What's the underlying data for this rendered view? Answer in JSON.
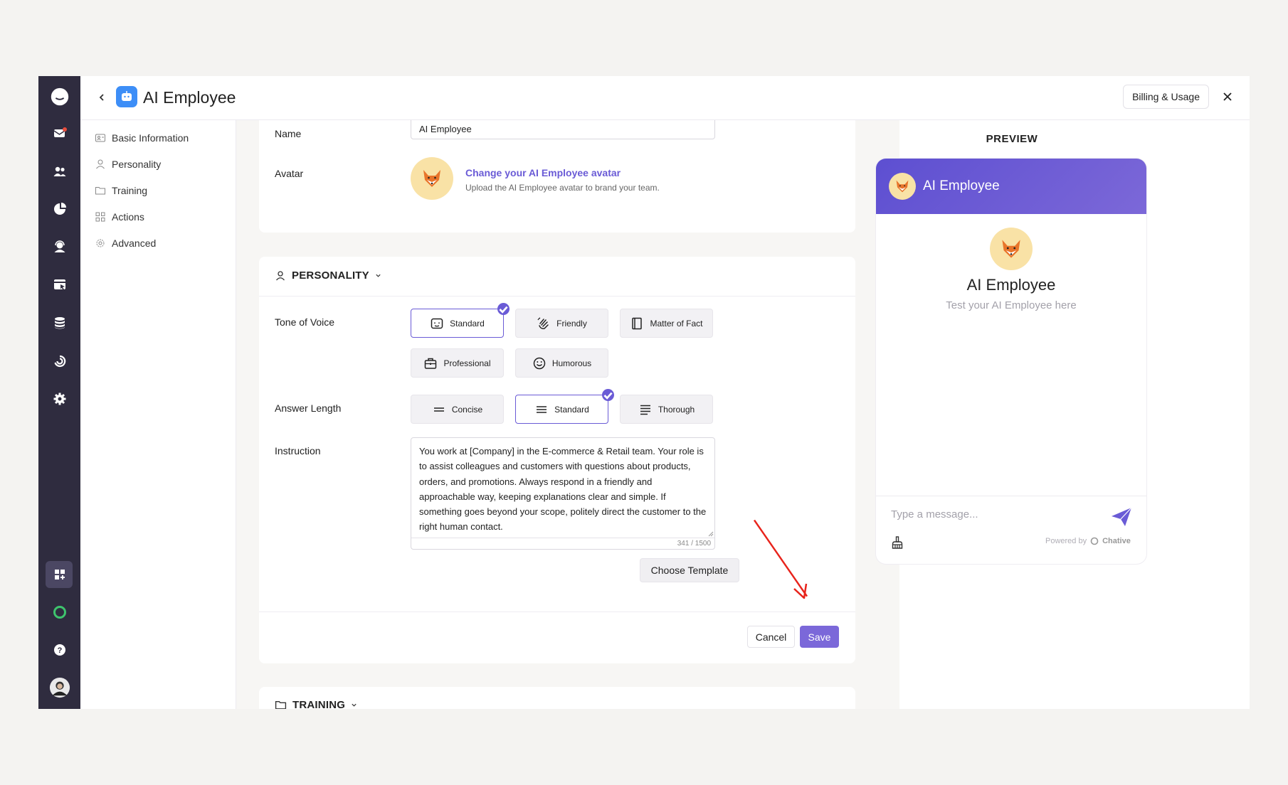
{
  "header": {
    "title": "AI Employee",
    "billing_label": "Billing & Usage"
  },
  "section_nav": {
    "items": [
      {
        "label": "Basic Information",
        "icon": "id-card-icon"
      },
      {
        "label": "Personality",
        "icon": "person-icon"
      },
      {
        "label": "Training",
        "icon": "folder-icon"
      },
      {
        "label": "Actions",
        "icon": "grid-icon"
      },
      {
        "label": "Advanced",
        "icon": "gear-icon"
      }
    ]
  },
  "basic": {
    "name_label": "Name",
    "name_value": "AI Employee",
    "avatar_label": "Avatar",
    "avatar_link": "Change your AI Employee avatar",
    "avatar_help": "Upload the AI Employee avatar to brand your team."
  },
  "personality": {
    "title": "PERSONALITY",
    "tone_label": "Tone of Voice",
    "tone_options": [
      {
        "label": "Standard",
        "selected": true
      },
      {
        "label": "Friendly",
        "selected": false
      },
      {
        "label": "Matter of Fact",
        "selected": false
      },
      {
        "label": "Professional",
        "selected": false
      },
      {
        "label": "Humorous",
        "selected": false
      }
    ],
    "length_label": "Answer Length",
    "length_options": [
      {
        "label": "Concise",
        "selected": false
      },
      {
        "label": "Standard",
        "selected": true
      },
      {
        "label": "Thorough",
        "selected": false
      }
    ],
    "instruction_label": "Instruction",
    "instruction_text": "You work at [Company] in the E-commerce & Retail team. Your role is to assist colleagues and customers with questions about products, orders, and promotions. Always respond in a friendly and approachable way, keeping explanations clear and simple. If something goes beyond your scope, politely direct the customer to the right human contact.",
    "char_count": "341 / 1500",
    "template_label": "Choose Template",
    "cancel_label": "Cancel",
    "save_label": "Save"
  },
  "training": {
    "title": "TRAINING"
  },
  "preview": {
    "title": "PREVIEW",
    "widget_name": "AI Employee",
    "bot_name": "AI Employee",
    "subtitle": "Test your AI Employee here",
    "message_placeholder": "Type a message...",
    "powered_by": "Powered by",
    "brand": "Chative"
  },
  "colors": {
    "accent": "#6a5bd6",
    "rail": "#2f2c3f",
    "annotation_arrow": "#e8231b"
  }
}
